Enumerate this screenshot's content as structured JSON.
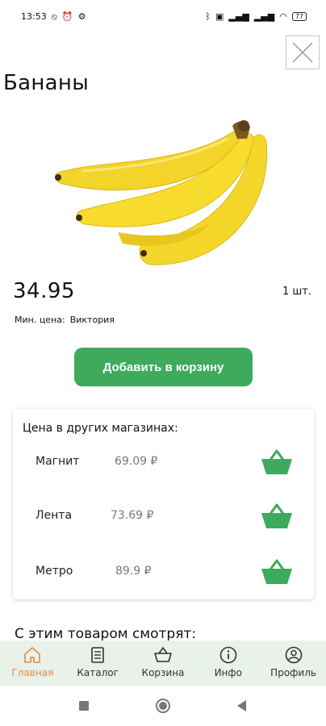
{
  "status_bar": {
    "time": "13:53",
    "battery": "77",
    "icons_left": [
      "mute-icon",
      "alarm-icon",
      "gear-icon"
    ],
    "icons_right": [
      "bluetooth-icon",
      "nfc-icon",
      "signal-icon",
      "signal-icon",
      "wifi-icon"
    ]
  },
  "product": {
    "title": "Бананы",
    "price": "34.95",
    "unit": "1 шт.",
    "min_price_label": "Мин. цена:",
    "min_price_store": "Виктория",
    "add_to_cart_label": "Добавить в корзину"
  },
  "other_shops": {
    "title": "Цена в других магазинах:",
    "shops": [
      {
        "name": "Магнит",
        "price": "69.09 ₽"
      },
      {
        "name": "Лента",
        "price": "73.69 ₽"
      },
      {
        "name": "Метро",
        "price": "89.9 ₽"
      }
    ]
  },
  "related": {
    "title": "С этим товаром смотрят:"
  },
  "bottom_nav": {
    "items": [
      {
        "label": "Главная",
        "icon": "home-icon",
        "active": true
      },
      {
        "label": "Каталог",
        "icon": "catalog-icon",
        "active": false
      },
      {
        "label": "Корзина",
        "icon": "basket-icon",
        "active": false
      },
      {
        "label": "Инфо",
        "icon": "info-icon",
        "active": false
      },
      {
        "label": "Профиль",
        "icon": "profile-icon",
        "active": false
      }
    ]
  },
  "colors": {
    "accent_green": "#3daa5c",
    "nav_background": "#e8f2e9",
    "active_nav": "#e88a3c"
  }
}
